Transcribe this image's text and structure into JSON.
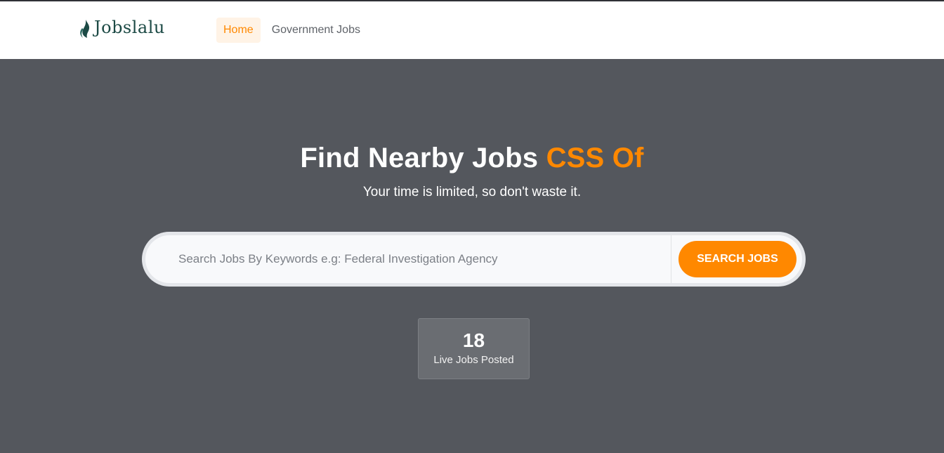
{
  "brand": {
    "name": "Jobslalu"
  },
  "nav": {
    "items": [
      {
        "label": "Home",
        "active": true
      },
      {
        "label": "Government Jobs",
        "active": false
      }
    ]
  },
  "hero": {
    "title": "Find Nearby Jobs",
    "title_accent": "CSS Of",
    "subtitle": "Your time is limited, so don't waste it."
  },
  "search": {
    "placeholder": "Search Jobs By Keywords e.g: Federal Investigation Agency",
    "value": "",
    "button_label": "SEARCH JOBS"
  },
  "stats": {
    "count": "18",
    "label": "Live Jobs Posted"
  },
  "colors": {
    "accent": "#ff8800",
    "hero_bg": "#54575d",
    "brand_green": "#1c4a45"
  }
}
